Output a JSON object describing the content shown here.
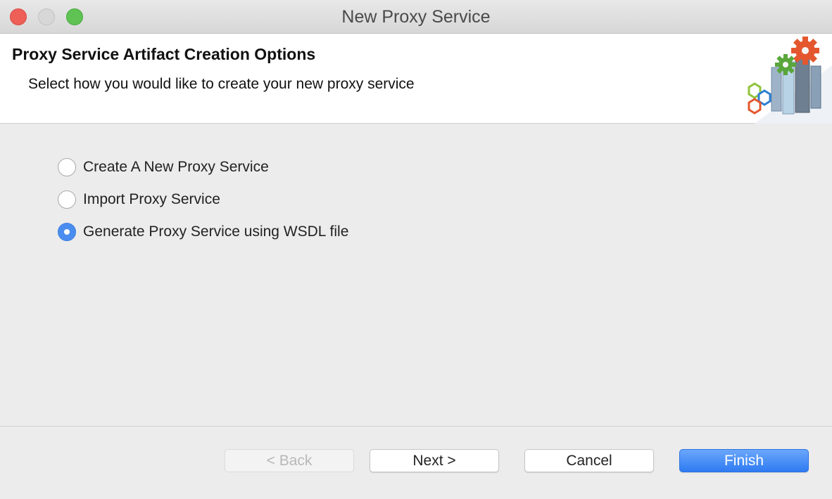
{
  "window": {
    "title": "New Proxy Service"
  },
  "header": {
    "title": "Proxy Service Artifact Creation Options",
    "subtitle": "Select how you would like to create your new proxy service",
    "graphic_icon": "gears-pillars-icon"
  },
  "options": [
    {
      "label": "Create A New Proxy Service",
      "selected": false
    },
    {
      "label": "Import Proxy Service",
      "selected": false
    },
    {
      "label": "Generate Proxy Service using WSDL file",
      "selected": true
    }
  ],
  "buttons": {
    "back_label": "< Back",
    "next_label": "Next >",
    "cancel_label": "Cancel",
    "finish_label": "Finish"
  },
  "colors": {
    "accent": "#2f7bf2",
    "radio_selected": "#4a8df0",
    "close": "#ee5f57",
    "zoom": "#5fc353"
  }
}
